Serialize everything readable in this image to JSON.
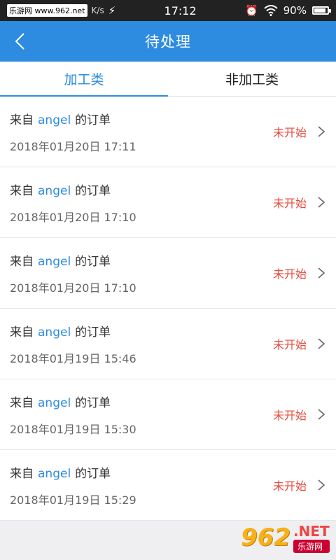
{
  "statusbar": {
    "watermark": "乐游网 www.962.net",
    "speed": "K/s",
    "time": "17:12",
    "battery": "90%",
    "battery_level": 0.9
  },
  "nav": {
    "title": "待处理"
  },
  "tabs": [
    {
      "label": "加工类",
      "active": true
    },
    {
      "label": "非加工类",
      "active": false
    }
  ],
  "orders": [
    {
      "prefix": "来自",
      "user": "angel",
      "suffix": "的订单",
      "time": "2018年01月20日 17:11",
      "status": "未开始"
    },
    {
      "prefix": "来自",
      "user": "angel",
      "suffix": "的订单",
      "time": "2018年01月20日 17:10",
      "status": "未开始"
    },
    {
      "prefix": "来自",
      "user": "angel",
      "suffix": "的订单",
      "time": "2018年01月20日 17:10",
      "status": "未开始"
    },
    {
      "prefix": "来自",
      "user": "angel",
      "suffix": "的订单",
      "time": "2018年01月19日 15:46",
      "status": "未开始"
    },
    {
      "prefix": "来自",
      "user": "angel",
      "suffix": "的订单",
      "time": "2018年01月19日 15:30",
      "status": "未开始"
    },
    {
      "prefix": "来自",
      "user": "angel",
      "suffix": "的订单",
      "time": "2018年01月19日 15:29",
      "status": "未开始"
    }
  ],
  "brand": {
    "number": "962",
    "net": ".NET",
    "cn": "乐游网"
  },
  "colors": {
    "primary": "#2d8be0",
    "status": "#e8493d"
  }
}
